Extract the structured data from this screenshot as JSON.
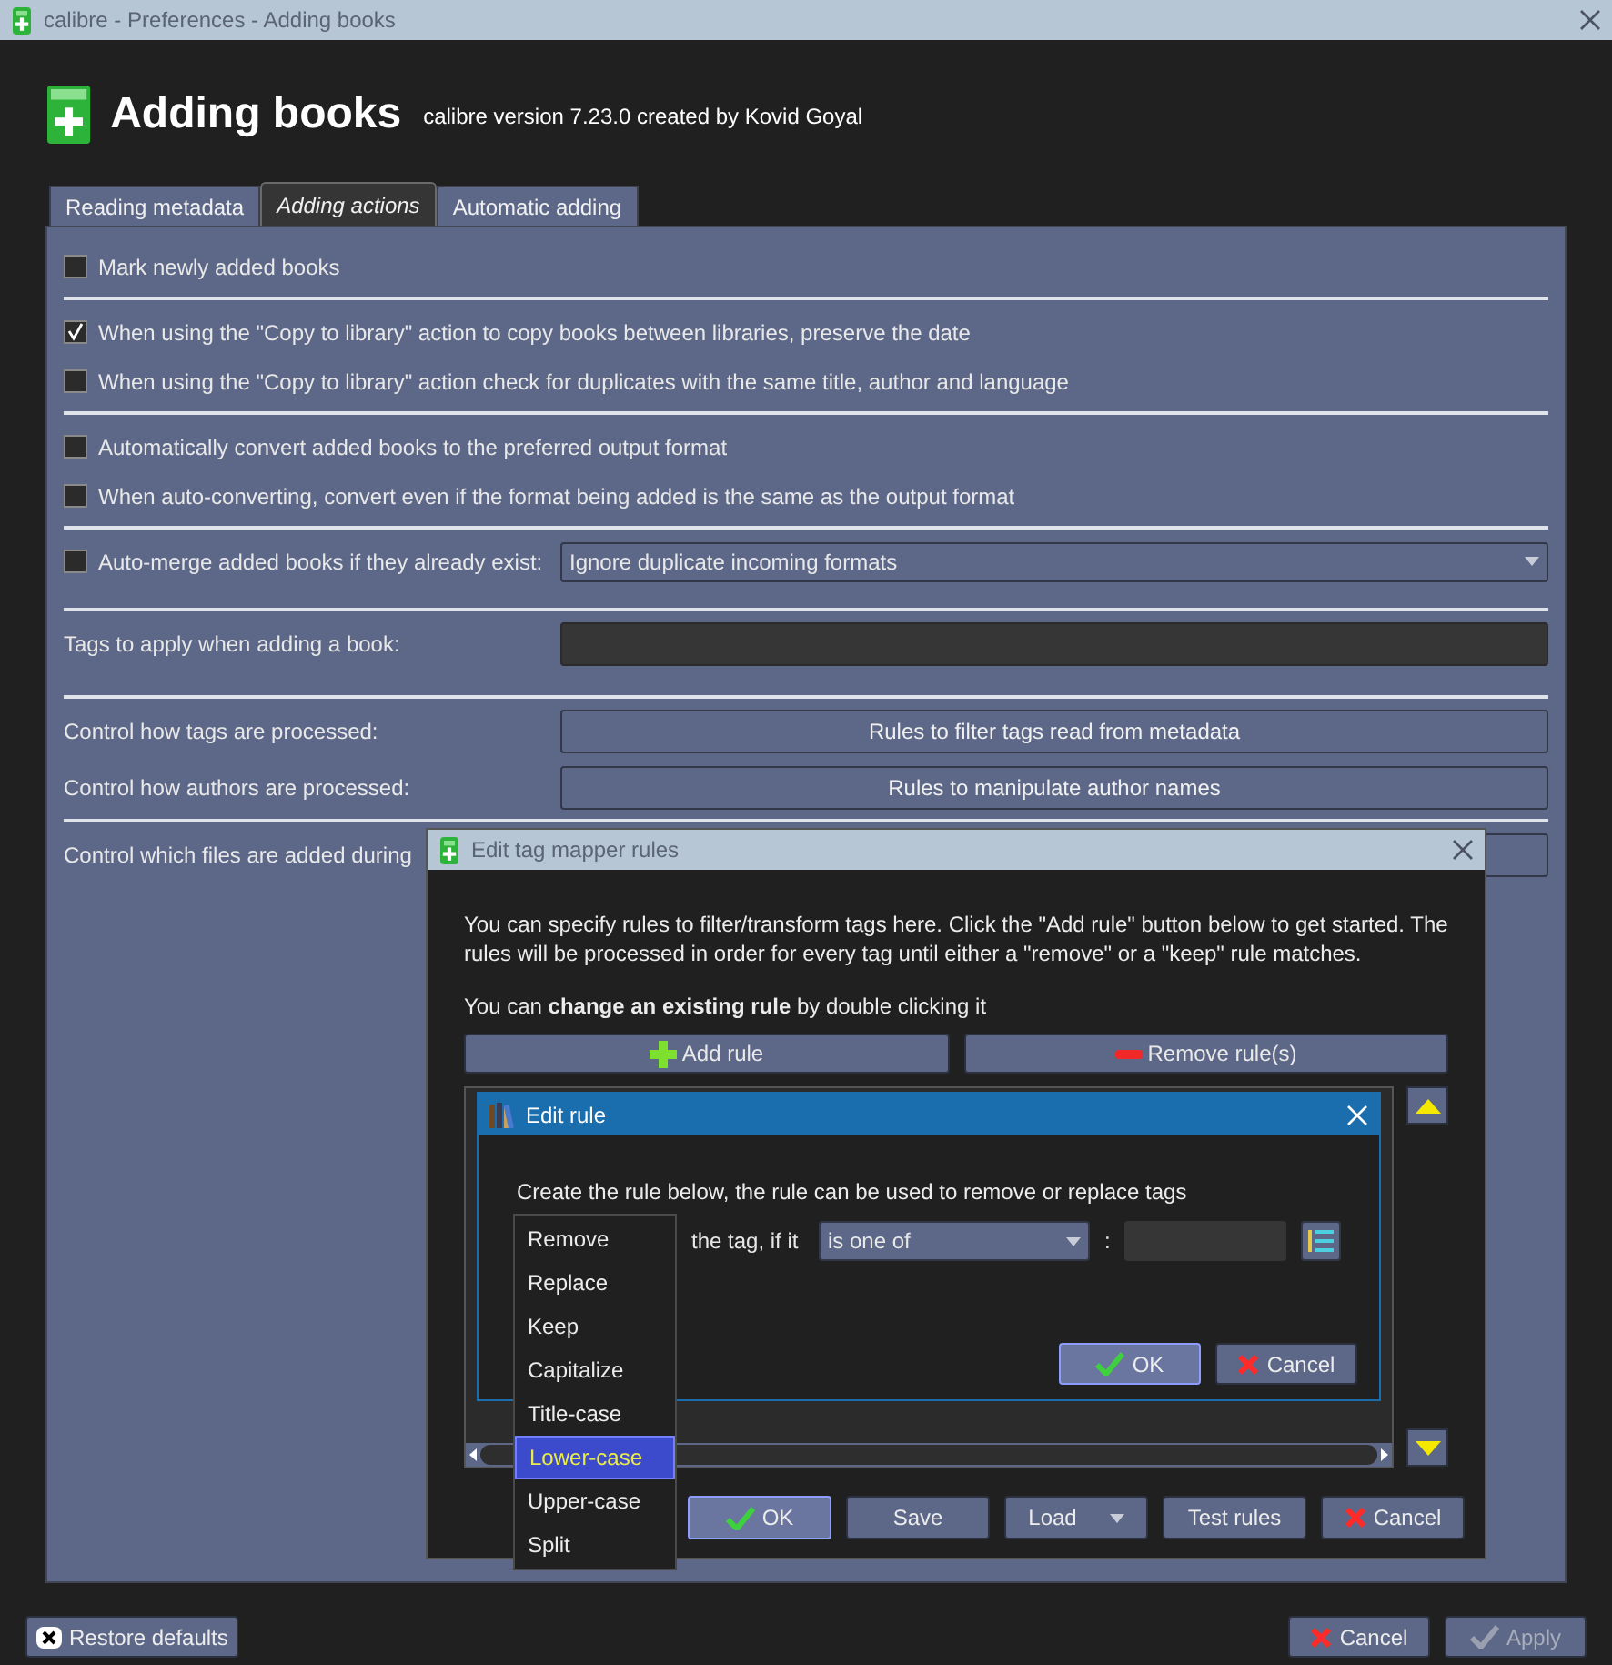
{
  "window": {
    "title": "calibre - Preferences - Adding books"
  },
  "header": {
    "title": "Adding books",
    "subtitle": "calibre version 7.23.0 created by Kovid Goyal"
  },
  "tabs": [
    {
      "label": "Reading metadata",
      "selected": false
    },
    {
      "label": "Adding actions",
      "selected": true
    },
    {
      "label": "Automatic adding",
      "selected": false
    }
  ],
  "sections": [
    {
      "rows": [
        {
          "kind": "checkbox",
          "label": "Mark newly added books",
          "checked": false
        }
      ]
    },
    {
      "rows": [
        {
          "kind": "checkbox",
          "label": "When using the  \"Copy to library\" action to copy books between libraries, preserve the date",
          "checked": true
        },
        {
          "kind": "checkbox",
          "label": "When using the \"Copy to library\" action check for duplicates with the same title, author and language",
          "checked": false
        }
      ]
    },
    {
      "rows": [
        {
          "kind": "checkbox",
          "label": "Automatically convert added books to the preferred output format",
          "checked": false
        },
        {
          "kind": "checkbox",
          "label": "When auto-converting, convert even if the format being added is the same as the output format",
          "checked": false
        }
      ]
    },
    {
      "rows": [
        {
          "kind": "combo",
          "label": "Auto-merge added books if they already exist:",
          "checked": false,
          "value": "Ignore duplicate incoming formats"
        }
      ]
    },
    {
      "rows": [
        {
          "kind": "field",
          "label": "Tags to apply when adding a book:"
        }
      ]
    },
    {
      "rows": [
        {
          "kind": "button",
          "label": "Control how tags are processed:",
          "button": "Rules to filter tags read from metadata"
        },
        {
          "kind": "button",
          "label": "Control how authors are processed:",
          "button": "Rules to manipulate author names"
        }
      ]
    },
    {
      "rows": [
        {
          "kind": "button",
          "label": "Control which files are added during"
        }
      ]
    }
  ],
  "footer_buttons": [
    {
      "label": "Restore defaults",
      "kind": "restore",
      "disabled": false
    },
    {
      "label": "Cancel",
      "kind": "cancel",
      "disabled": false
    },
    {
      "label": "Apply",
      "kind": "ok",
      "disabled": true
    }
  ],
  "tag_mapper": {
    "title": "Edit tag mapper rules",
    "intro": "You can specify rules to filter/transform tags here. Click the \"Add rule\" button below to get started. The rules will be processed in order for every tag until either a \"remove\" or a \"keep\" rule matches.",
    "hint": "You can **change an existing rule** by double clicking it",
    "add_button": "Add rule",
    "remove_button": "Remove rule(s)",
    "buttons": [
      {
        "label": "OK",
        "kind": "ok",
        "default": true
      },
      {
        "label": "Save",
        "kind": "plain",
        "default": false
      },
      {
        "label": "Load",
        "kind": "menu",
        "default": false
      },
      {
        "label": "Test rules",
        "kind": "plain",
        "default": false
      },
      {
        "label": "Cancel",
        "kind": "cancel",
        "default": false
      }
    ]
  },
  "edit_rule": {
    "title": "Edit rule",
    "text": "Create the rule below, the rule can be used to remove or replace tags",
    "condition": "the tag, if it",
    "match": "is one of",
    "separator": ":",
    "buttons": [
      {
        "label": "OK",
        "kind": "ok",
        "default": true
      },
      {
        "label": "Cancel",
        "kind": "cancel",
        "default": false
      }
    ]
  },
  "action_menu": [
    {
      "label": "Remove",
      "selected": false
    },
    {
      "label": "Replace",
      "selected": false
    },
    {
      "label": "Keep",
      "selected": false
    },
    {
      "label": "Capitalize",
      "selected": false
    },
    {
      "label": "Title-case",
      "selected": false
    },
    {
      "label": "Lower-case",
      "selected": true
    },
    {
      "label": "Upper-case",
      "selected": false
    },
    {
      "label": "Split",
      "selected": false
    }
  ]
}
